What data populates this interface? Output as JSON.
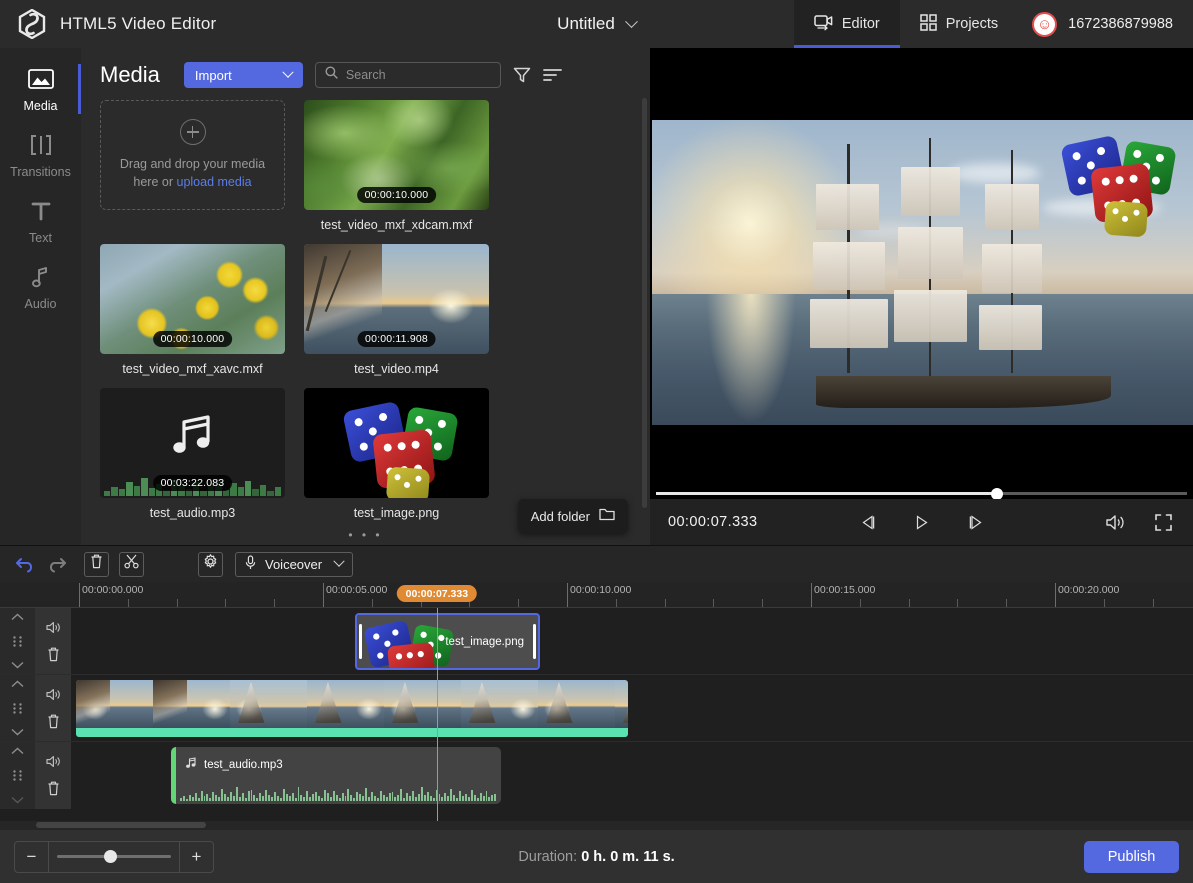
{
  "header": {
    "app_title": "HTML5 Video Editor",
    "logo_icon": "cube-logo-icon",
    "project_name": "Untitled",
    "project_chevron_icon": "chevron-down-icon",
    "tabs": [
      {
        "label": "Editor",
        "icon": "video-camera-icon",
        "active": true
      },
      {
        "label": "Projects",
        "icon": "grid-squares-icon",
        "active": false
      }
    ],
    "user": {
      "name": "1672386879988",
      "avatar_icon": "smiley-face-icon"
    }
  },
  "rail": {
    "items": [
      {
        "label": "Media",
        "icon": "image-icon",
        "active": true
      },
      {
        "label": "Transitions",
        "icon": "transitions-icon",
        "active": false
      },
      {
        "label": "Text",
        "icon": "text-t-icon",
        "active": false
      },
      {
        "label": "Audio",
        "icon": "music-note-icon",
        "active": false
      }
    ]
  },
  "media": {
    "title": "Media",
    "import_label": "Import",
    "import_chevron_icon": "chevron-down-icon",
    "search_placeholder": "Search",
    "search_value": "",
    "search_icon": "search-icon",
    "filter_icon": "filter-funnel-icon",
    "sort_icon": "sort-lines-icon",
    "dropzone": {
      "plus_icon": "plus-circle-icon",
      "line1": "Drag and drop your media",
      "line2_prefix": "here or ",
      "link": "upload media"
    },
    "items": [
      {
        "name": "test_video_mxf_xdcam.mxf",
        "duration": "00:00:10.000",
        "kind": "video-leaves"
      },
      {
        "name": "test_video_mxf_xavc.mxf",
        "duration": "00:00:10.000",
        "kind": "video-flowers"
      },
      {
        "name": "test_video.mp4",
        "duration": "00:00:11.908",
        "kind": "video-ship"
      },
      {
        "name": "test_audio.mp3",
        "duration": "00:03:22.083",
        "kind": "audio"
      },
      {
        "name": "test_image.png",
        "duration": "",
        "kind": "image-dice"
      }
    ],
    "add_folder_label": "Add folder",
    "add_folder_icon": "folder-icon",
    "overflow_dots": "• • •"
  },
  "preview": {
    "current_time": "00:00:07.333",
    "progress_percent": 64,
    "controls": [
      {
        "name": "step-back-button",
        "icon": "step-backward-icon"
      },
      {
        "name": "play-button",
        "icon": "play-icon"
      },
      {
        "name": "step-forward-button",
        "icon": "step-forward-icon"
      }
    ],
    "volume_icon": "speaker-volume-icon",
    "fullscreen_icon": "fullscreen-icon"
  },
  "timeline": {
    "toolbar": [
      {
        "name": "undo-button",
        "icon": "undo-arrow-icon"
      },
      {
        "name": "redo-button",
        "icon": "redo-arrow-icon"
      },
      {
        "name": "delete-button",
        "icon": "trash-icon"
      },
      {
        "name": "split-button",
        "icon": "scissors-icon"
      },
      {
        "name": "settings-button",
        "icon": "gear-icon"
      }
    ],
    "voiceover_label": "Voiceover",
    "voiceover_icon": "microphone-icon",
    "voiceover_chevron_icon": "chevron-down-icon",
    "ruler_labels": [
      "00:00:00.000",
      "00:00:05.000",
      "00:00:10.000",
      "00:00:15.000",
      "00:00:20.000"
    ],
    "playhead_time": "00:00:07.333",
    "tracks": [
      {
        "type": "image",
        "clip_label": "test_image.png",
        "selected": true,
        "controls": [
          "move-up-icon",
          "drag-handle-icon",
          "move-down-icon",
          "mute-speaker-icon",
          "trash-icon"
        ]
      },
      {
        "type": "video",
        "clip_label": "",
        "selected": false,
        "controls": [
          "move-up-icon",
          "drag-handle-icon",
          "move-down-icon",
          "mute-speaker-icon",
          "trash-icon"
        ]
      },
      {
        "type": "audio",
        "clip_label": "test_audio.mp3",
        "clip_icon": "music-note-icon",
        "selected": false,
        "controls": [
          "move-up-icon",
          "drag-handle-icon",
          "move-down-icon",
          "mute-speaker-icon",
          "trash-icon"
        ]
      }
    ]
  },
  "footer": {
    "zoom_out_label": "−",
    "zoom_in_label": "+",
    "zoom_percent": 47,
    "duration_label": "Duration: ",
    "duration_value": "0 h. 0 m. 11 s.",
    "publish_label": "Publish"
  },
  "colors": {
    "accent": "#5468e0",
    "playhead": "#e08a33",
    "video_bar": "#5ae3b0",
    "audio_edge": "#63d678"
  }
}
